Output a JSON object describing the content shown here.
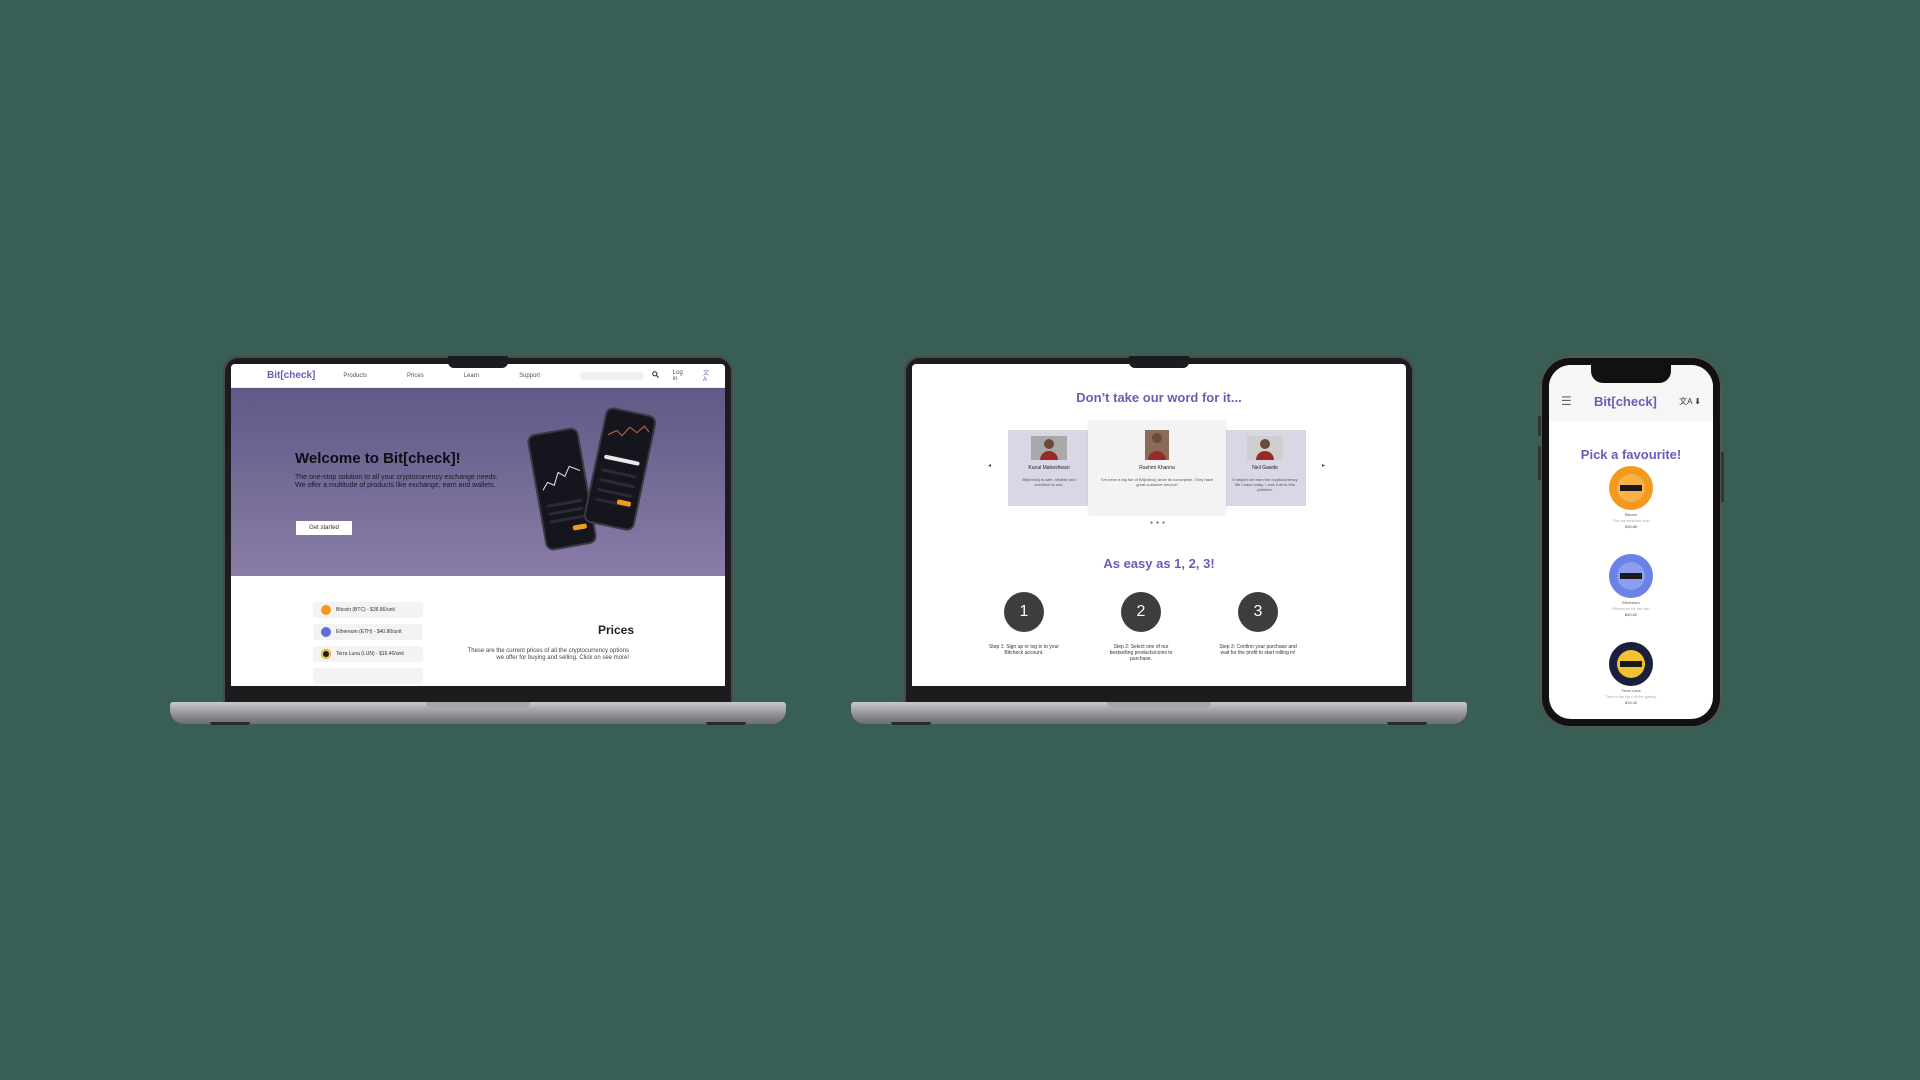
{
  "home": {
    "brand": "Bit[check]",
    "nav": [
      "Products",
      "Prices",
      "Learn",
      "Support"
    ],
    "login": "Log in",
    "lang_icons": "文A",
    "hero_title": "Welcome to Bit[check]!",
    "hero_text": "The one-stop solution to all your cryptocurrency exchange needs. We offer a multitude of products like exchange, earn and wallets.",
    "cta": "Get started",
    "prices_title": "Prices",
    "prices_text": "These are the current prices of all the cryptocurrency options we offer for buying and selling. Click on see more!",
    "price_rows": [
      {
        "label": "Bitcoin (BTC) - $36.86/unit",
        "color": "#f39a1e"
      },
      {
        "label": "Ethereum (ETH) - $40.80/unit",
        "color": "#5b6fd8"
      },
      {
        "label": "Terra Luna (LUN) - $16.40/unit",
        "color": "#1a1a2e"
      }
    ]
  },
  "testimonials": {
    "title": "Don’t take our word for it...",
    "cards": [
      {
        "name": "Kunal Maheshwari",
        "quote": "Bit[check] is safe, reliable and excellent to use."
      },
      {
        "name": "Rashmi Khanna",
        "quote": "I’ve been a big fan of Bit[check] since its conception. They have great customer service!"
      },
      {
        "name": "Neil Gawde",
        "quote": "It helped me earn the cryptocurrency life I have today. I owe it all to this platform."
      }
    ],
    "arrow_left": "◂",
    "arrow_right": "▸",
    "dots": "●●●",
    "easy_title": "As easy as 1, 2, 3!",
    "steps": [
      {
        "num": "1",
        "text": "Step 1: Sign up or log in to your Bitcheck account."
      },
      {
        "num": "2",
        "text": "Step 2: Select one of our bestselling products/coins to purchase."
      },
      {
        "num": "3",
        "text": "Step 3: Confirm your purchase and wait for the profit to start rolling in!"
      }
    ]
  },
  "mobile": {
    "menu_icon": "☰",
    "brand": "Bit[check]",
    "lang_icons": "文A ⬇",
    "pick_title": "Pick a favourite!",
    "coins": [
      {
        "name": "Bitcoin",
        "sub": "The cornerstone coin",
        "price": "$36.86",
        "outer": "#f39a1e",
        "inner": "#f7b24a"
      },
      {
        "name": "Ethereum",
        "sub": "Ethereum for the win",
        "price": "$40.80",
        "outer": "#6b82e6",
        "inner": "#8c9ef0"
      },
      {
        "name": "Terra Luna",
        "sub": "Terra's the light of the galaxy",
        "price": "$16.40",
        "outer": "#1a1f3d",
        "inner": "#f2c230"
      }
    ]
  }
}
